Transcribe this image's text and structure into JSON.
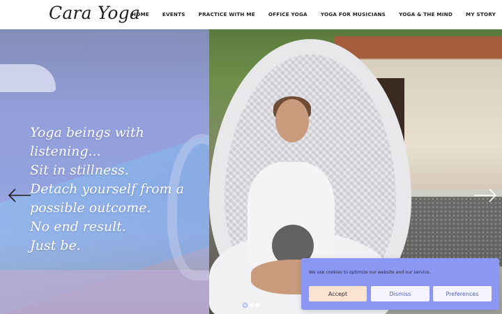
{
  "header": {
    "logo": "Cara Yoga",
    "nav": [
      "HOME",
      "EVENTS",
      "PRACTICE WITH ME",
      "OFFICE YOGA",
      "YOGA FOR MUSICIANS",
      "YOGA & THE MIND",
      "MY STORY"
    ]
  },
  "hero": {
    "quote_lines": [
      "Yoga beings with",
      "listening...",
      "Sit in stillness.",
      "Detach yourself from a",
      "possible outcome.",
      "No end result.",
      "Just be."
    ],
    "prev_icon": "arrow-left-icon",
    "next_icon": "arrow-right-icon",
    "slide_count": 3,
    "active_slide": 1
  },
  "cookie": {
    "text": "We use cookies to optimize our website and our service.",
    "accept": "Accept",
    "dismiss": "Dismiss",
    "preferences": "Preferences"
  },
  "colors": {
    "overlay": "#8c97f3",
    "accept_bg": "#fbe3cf",
    "link": "#4f5fbf"
  }
}
